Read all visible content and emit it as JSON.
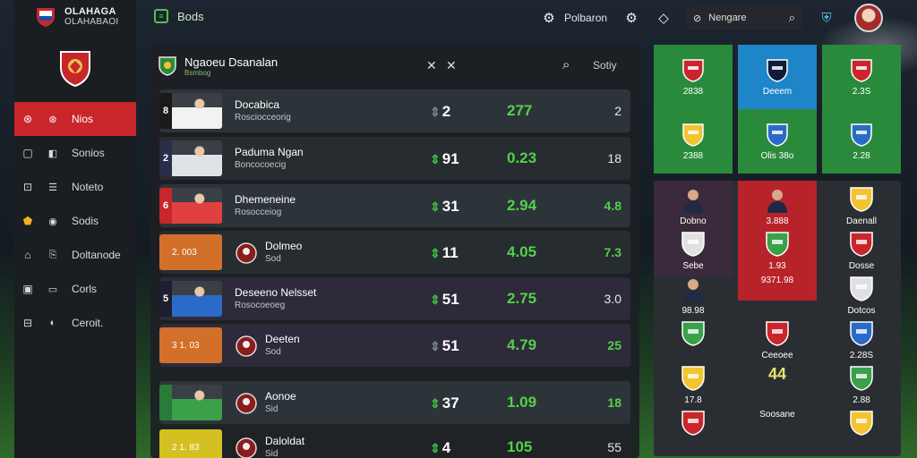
{
  "app": {
    "brand_line1": "OLAHAGA",
    "brand_line2": "OLAHABAOI"
  },
  "sidebar": {
    "items": [
      {
        "label": "Nios",
        "icon": "soccer-ball-icon",
        "active": true
      },
      {
        "label": "Sonios",
        "icon": "bag-icon",
        "active": false
      },
      {
        "label": "Noteto",
        "icon": "lock-icon",
        "active": false
      },
      {
        "label": "Sodis",
        "icon": "shield-icon",
        "active": false
      },
      {
        "label": "Doltanode",
        "icon": "bell-icon",
        "active": false
      },
      {
        "label": "Corls",
        "icon": "card-icon",
        "active": false
      },
      {
        "label": "Ceroit.",
        "icon": "badge-icon",
        "active": false
      }
    ]
  },
  "topbar": {
    "title": "Bods",
    "link_label": "Polbaron",
    "search_label": "Nengare"
  },
  "panel": {
    "title": "Ngaoeu Dsanalan",
    "subtitle": "Bsmbog",
    "sort_label": "Sotiy",
    "rows": [
      {
        "index": "8",
        "name": "Docabica",
        "sub": "Rosciocceorig",
        "c1": "2",
        "c2": "277",
        "c3": "2",
        "thumb": "player-white",
        "arrow": "gray",
        "c3green": false
      },
      {
        "index": "2",
        "name": "Paduma Ngan",
        "sub": "Boncocoecig",
        "c1": "91",
        "c2": "0.23",
        "c3": "18",
        "thumb": "player-dark",
        "arrow": "green",
        "c3green": false
      },
      {
        "index": "6",
        "name": "Dhemeneine",
        "sub": "Rosocceiog",
        "c1": "31",
        "c2": "2.94",
        "c3": "4.8",
        "thumb": "player-red",
        "arrow": "green",
        "c3green": true
      },
      {
        "index": "",
        "name": "Dolmeo",
        "sub": "Sod",
        "c1": "11",
        "c2": "4.05",
        "c3": "7.3",
        "thumb": "orange",
        "thumb_label": "2. 003",
        "arrow": "green",
        "c3green": true
      },
      {
        "index": "5",
        "name": "Deseeno Nelsset",
        "sub": "Rosocoeoeg",
        "c1": "51",
        "c2": "2.75",
        "c3": "3.0",
        "thumb": "player-blue",
        "arrow": "green",
        "c3green": false
      },
      {
        "index": "",
        "name": "Deeten",
        "sub": "Sod",
        "c1": "51",
        "c2": "4.79",
        "c3": "25",
        "thumb": "orange",
        "thumb_label": "3 1. 03",
        "arrow": "gray",
        "c3green": true
      },
      {
        "index": "",
        "name": "Aonoe",
        "sub": "Sid",
        "c1": "37",
        "c2": "1.09",
        "c3": "18",
        "thumb": "player-green",
        "arrow": "green",
        "c3green": true
      },
      {
        "index": "",
        "name": "Daloldat",
        "sub": "Sid",
        "c1": "4",
        "c2": "105",
        "c3": "55",
        "thumb": "yellow",
        "thumb_label": "2 1. 83",
        "arrow": "green",
        "c3green": false
      }
    ]
  },
  "team_tiles": [
    {
      "label": "2838",
      "bg": "#2a8a3c",
      "crest": "#c8262b"
    },
    {
      "label": "Deeem",
      "bg": "#1e86c8",
      "crest": "#0f1d3a"
    },
    {
      "label": "2.3S",
      "bg": "#2a8a3c",
      "crest": "#c8262b"
    },
    {
      "label": "2388",
      "bg": "#2a8a3c",
      "crest": "#f2c431"
    },
    {
      "label": "Olis 38o",
      "bg": "#2a8a3c",
      "crest": "#2b6bc8"
    },
    {
      "label": "2.28",
      "bg": "#2a8a3c",
      "crest": "#2b6bc8"
    }
  ],
  "team_cells": [
    {
      "label": "Dobno",
      "kind": "player"
    },
    {
      "label": "3.888",
      "kind": "player"
    },
    {
      "label": "Daenall",
      "kind": "crest"
    },
    {
      "label": "Sebe",
      "kind": "crest"
    },
    {
      "label": "1.93",
      "kind": "crest"
    },
    {
      "label": "Dosse",
      "kind": "crest"
    },
    {
      "label": "98.98",
      "kind": "player"
    },
    {
      "label": "9371.98",
      "kind": "none"
    },
    {
      "label": "Dotcos",
      "kind": "crest"
    },
    {
      "label": "",
      "kind": "crest"
    },
    {
      "label": "Ceeoee",
      "kind": "crest"
    },
    {
      "label": "2.28S",
      "kind": "crest"
    },
    {
      "label": "17.8",
      "kind": "crest"
    },
    {
      "label": "44",
      "kind": "big"
    },
    {
      "label": "2.88",
      "kind": "crest"
    },
    {
      "label": "",
      "kind": "crest"
    },
    {
      "label": "Soosane",
      "kind": "none"
    },
    {
      "label": "",
      "kind": "crest"
    }
  ]
}
